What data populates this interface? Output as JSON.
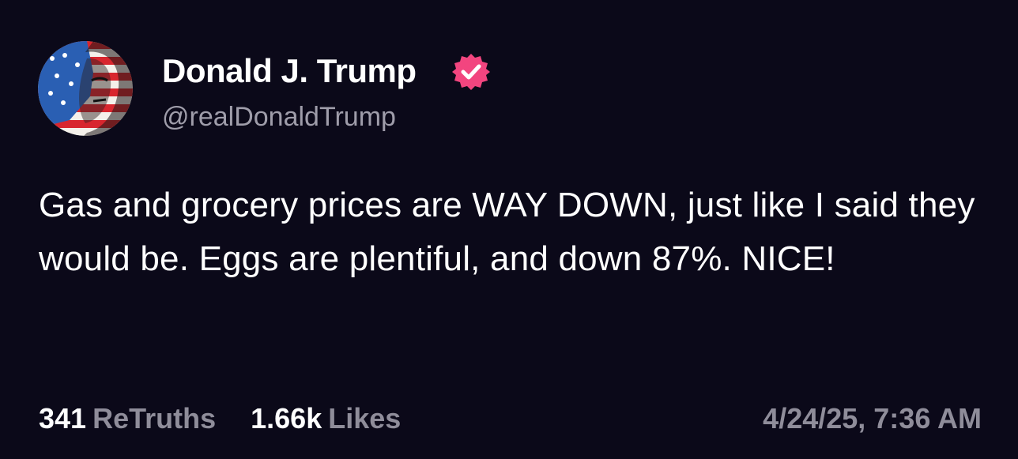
{
  "post": {
    "author": {
      "display_name": "Donald J. Trump",
      "handle": "@realDonaldTrump",
      "verified_icon": "verified-badge-icon",
      "avatar_icon": "flag-portrait-avatar"
    },
    "body": "Gas and grocery prices are WAY DOWN, just like I said they would be. Eggs are plentiful, and down 87%. NICE!",
    "stats": {
      "retruths_count": "341",
      "retruths_label": "ReTruths",
      "likes_count": "1.66k",
      "likes_label": "Likes"
    },
    "timestamp": "4/24/25, 7:36 AM"
  },
  "colors": {
    "background": "#0b0919",
    "text_primary": "#ffffff",
    "text_secondary": "#9f9daa",
    "verified_badge": "#f2457f"
  }
}
